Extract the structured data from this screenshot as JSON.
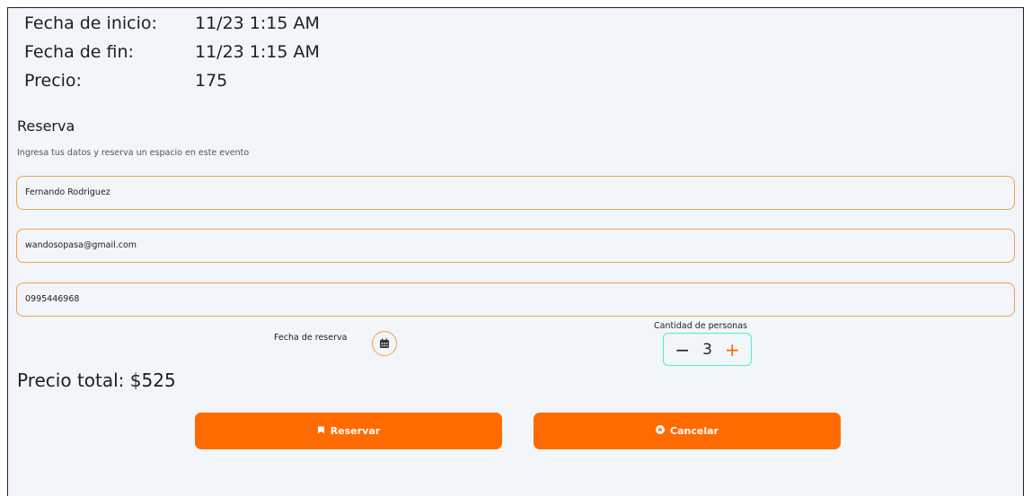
{
  "event": {
    "start_label": "Fecha de inicio:",
    "start_value": "11/23 1:15 AM",
    "end_label": "Fecha de fin:",
    "end_value": "11/23 1:15 AM",
    "price_label": "Precio:",
    "price_value": "175"
  },
  "reservation": {
    "title": "Reserva",
    "subtitle": "Ingresa tus datos y reserva un espacio en este evento",
    "name_value": "Fernando Rodriguez",
    "email_value": "wandosopasa@gmail.com",
    "phone_value": "0995446968",
    "date_label": "Fecha de reserva",
    "date_icon": "calendar-icon",
    "quantity_label": "Cantidad de personas",
    "quantity_value": "3",
    "total_text": "Precio total: $525"
  },
  "actions": {
    "reserve_label": "Reservar",
    "reserve_icon": "bookmark-icon",
    "cancel_label": "Cancelar",
    "cancel_icon": "x-circle-icon"
  },
  "colors": {
    "accent": "#ff6b00",
    "field_border": "#f5a04a",
    "stepper_border": "#4ff0c3",
    "panel_bg": "#f2f5f9"
  }
}
